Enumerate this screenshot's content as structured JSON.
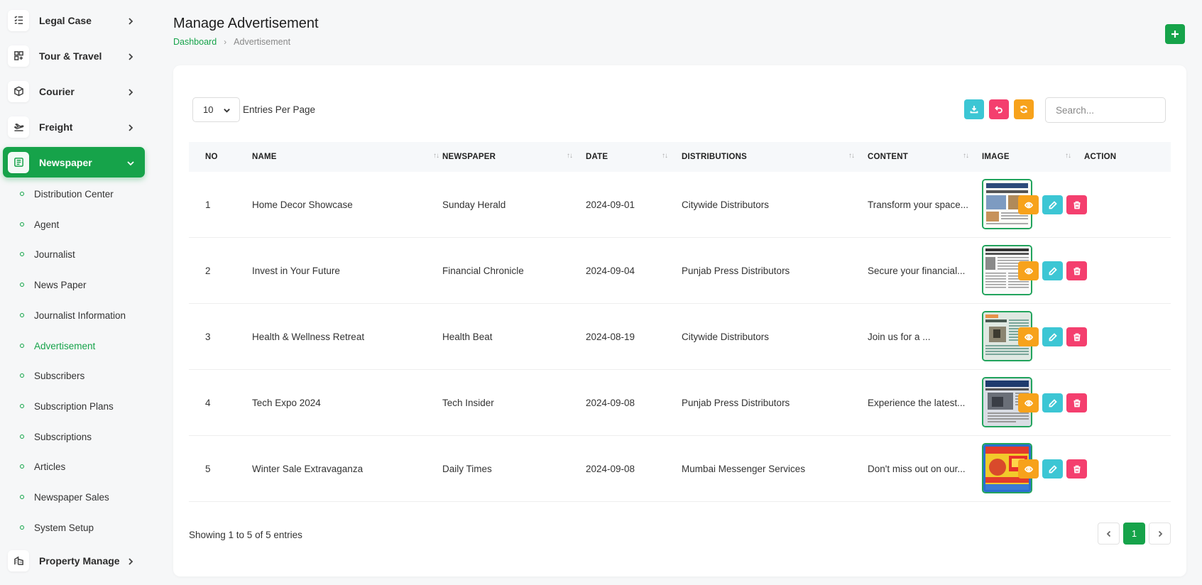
{
  "sidebar": {
    "top_items": [
      {
        "label": "Legal Case",
        "icon": "checklist-icon"
      },
      {
        "label": "Tour & Travel",
        "icon": "grid-icon"
      },
      {
        "label": "Courier",
        "icon": "box-icon"
      },
      {
        "label": "Freight",
        "icon": "plane-icon"
      }
    ],
    "active_item": {
      "label": "Newspaper",
      "icon": "newspaper-icon"
    },
    "sub_items": [
      "Distribution Center",
      "Agent",
      "Journalist",
      "News Paper",
      "Journalist Information",
      "Advertisement",
      "Subscribers",
      "Subscription Plans",
      "Subscriptions",
      "Articles",
      "Newspaper Sales",
      "System Setup"
    ],
    "active_sub": "Advertisement",
    "bottom_item": {
      "label": "Property Manage",
      "icon": "building-icon"
    }
  },
  "header": {
    "title": "Manage Advertisement",
    "breadcrumb_home": "Dashboard",
    "breadcrumb_current": "Advertisement"
  },
  "toolbar": {
    "per_page_value": "10",
    "per_page_label": "Entries Per Page",
    "search_placeholder": "Search..."
  },
  "table": {
    "columns": [
      "NO",
      "NAME",
      "NEWSPAPER",
      "DATE",
      "DISTRIBUTIONS",
      "CONTENT",
      "IMAGE",
      "ACTION"
    ],
    "rows": [
      {
        "no": "1",
        "name": "Home Decor Showcase",
        "newspaper": "Sunday Herald",
        "date": "2024-09-01",
        "distribution": "Citywide Distributors",
        "content": "Transform your space..."
      },
      {
        "no": "2",
        "name": "Invest in Your Future",
        "newspaper": "Financial Chronicle",
        "date": "2024-09-04",
        "distribution": "Punjab Press Distributors",
        "content": "Secure your financial..."
      },
      {
        "no": "3",
        "name": "Health & Wellness Retreat",
        "newspaper": "Health Beat",
        "date": "2024-08-19",
        "distribution": "Citywide Distributors",
        "content": "Join us for a ..."
      },
      {
        "no": "4",
        "name": "Tech Expo 2024",
        "newspaper": "Tech Insider",
        "date": "2024-09-08",
        "distribution": "Punjab Press Distributors",
        "content": "Experience the latest..."
      },
      {
        "no": "5",
        "name": "Winter Sale Extravaganza",
        "newspaper": "Daily Times",
        "date": "2024-09-08",
        "distribution": "Mumbai Messenger Services",
        "content": "Don't miss out on our..."
      }
    ]
  },
  "footer": {
    "showing_text": "Showing 1 to 5 of 5 entries",
    "current_page": "1"
  },
  "colors": {
    "primary": "#16a34a",
    "view": "#f7a21b",
    "edit": "#3cc6d4",
    "delete": "#f43f6e",
    "download": "#3cc6d4",
    "reset": "#f43f6e",
    "refresh": "#f7a21b"
  }
}
